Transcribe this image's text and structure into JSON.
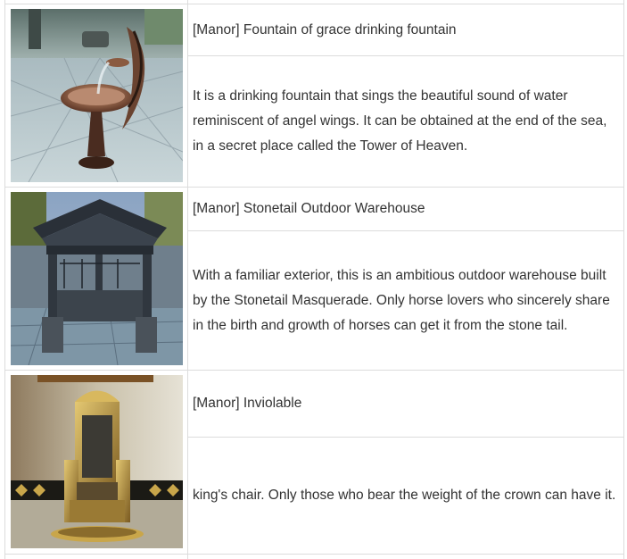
{
  "items": [
    {
      "title": "[Manor] Fountain of grace drinking fountain",
      "description": "It is a drinking fountain that sings the beautiful sound of water reminiscent of angel wings. It can be obtained at the end of the sea, in a secret place called the Tower of Heaven.",
      "image_subject": "ornate bronze angel-wing drinking fountain on stone plaza"
    },
    {
      "title": "[Manor] Stonetail Outdoor Warehouse",
      "description": "With a familiar exterior, this is an ambitious outdoor warehouse built by the Stonetail Masquerade. Only horse lovers who sincerely share in the birth and growth of horses can get it from the stone tail.",
      "image_subject": "dark wooden open-sided warehouse pavilion on stone courtyard"
    },
    {
      "title": "[Manor] Inviolable",
      "description": "king's chair. Only those who bear the weight of the crown can have it.",
      "image_subject": "gilded royal throne against pale wall"
    }
  ]
}
